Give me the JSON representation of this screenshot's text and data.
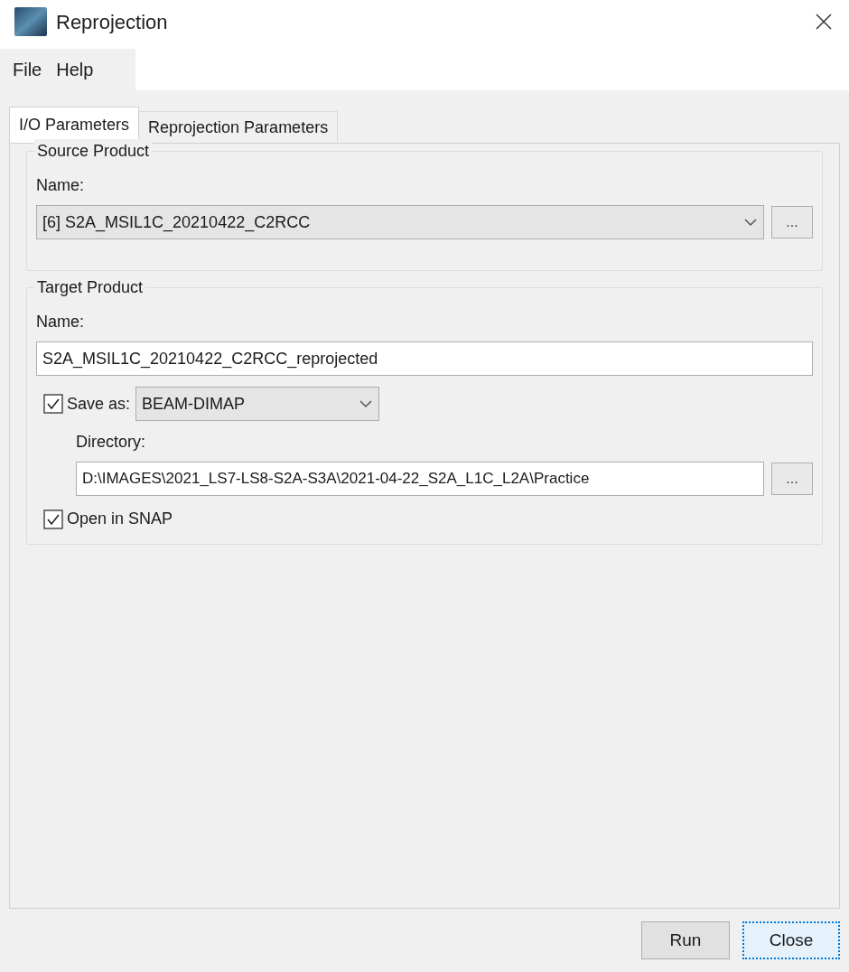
{
  "window": {
    "title": "Reprojection"
  },
  "menu": [
    "File",
    "Help"
  ],
  "tabs": [
    {
      "label": "I/O Parameters",
      "selected": true
    },
    {
      "label": "Reprojection Parameters",
      "selected": false
    }
  ],
  "source_product": {
    "title": "Source Product",
    "name_label": "Name:",
    "name_value": "[6] S2A_MSIL1C_20210422_C2RCC",
    "browse": "..."
  },
  "target_product": {
    "title": "Target Product",
    "name_label": "Name:",
    "name_value": "S2A_MSIL1C_20210422_C2RCC_reprojected",
    "save_as": {
      "label": "Save as:",
      "checked": true,
      "format": "BEAM-DIMAP"
    },
    "directory": {
      "label": "Directory:",
      "value": "D:\\IMAGES\\2021_LS7-LS8-S2A-S3A\\2021-04-22_S2A_L1C_L2A\\Practice",
      "browse": "..."
    },
    "open_in_snap": {
      "label": "Open in SNAP",
      "checked": true
    }
  },
  "buttons": [
    {
      "label": "Run",
      "focused": false
    },
    {
      "label": "Close",
      "focused": true
    }
  ]
}
